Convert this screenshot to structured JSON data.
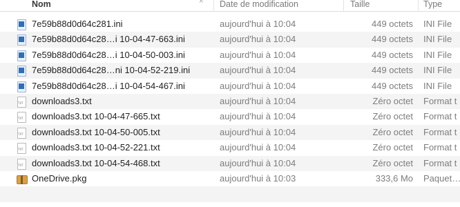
{
  "columns": {
    "name": "Nom",
    "date": "Date de modification",
    "size": "Taille",
    "type": "Type"
  },
  "sort_indicator": "^",
  "files": [
    {
      "name": "7e59b88d0d64c281.ini",
      "date": "aujourd'hui à 10:04",
      "size": "449 octets",
      "type": "INI File",
      "icon": "ini-file-icon"
    },
    {
      "name": "7e59b88d0d64c28…i 10-04-47-663.ini",
      "date": "aujourd'hui à 10:04",
      "size": "449 octets",
      "type": "INI File",
      "icon": "ini-file-icon"
    },
    {
      "name": "7e59b88d0d64c28…i 10-04-50-003.ini",
      "date": "aujourd'hui à 10:04",
      "size": "449 octets",
      "type": "INI File",
      "icon": "ini-file-icon"
    },
    {
      "name": "7e59b88d0d64c28…ni 10-04-52-219.ini",
      "date": "aujourd'hui à 10:04",
      "size": "449 octets",
      "type": "INI File",
      "icon": "ini-file-icon"
    },
    {
      "name": "7e59b88d0d64c28…i 10-04-54-467.ini",
      "date": "aujourd'hui à 10:04",
      "size": "449 octets",
      "type": "INI File",
      "icon": "ini-file-icon"
    },
    {
      "name": "downloads3.txt",
      "date": "aujourd'hui à 10:04",
      "size": "Zéro octet",
      "type": "Format t",
      "icon": "text-file-icon"
    },
    {
      "name": "downloads3.txt 10-04-47-665.txt",
      "date": "aujourd'hui à 10:04",
      "size": "Zéro octet",
      "type": "Format t",
      "icon": "text-file-icon"
    },
    {
      "name": "downloads3.txt 10-04-50-005.txt",
      "date": "aujourd'hui à 10:04",
      "size": "Zéro octet",
      "type": "Format t",
      "icon": "text-file-icon"
    },
    {
      "name": "downloads3.txt 10-04-52-221.txt",
      "date": "aujourd'hui à 10:04",
      "size": "Zéro octet",
      "type": "Format t",
      "icon": "text-file-icon"
    },
    {
      "name": "downloads3.txt 10-04-54-468.txt",
      "date": "aujourd'hui à 10:04",
      "size": "Zéro octet",
      "type": "Format t",
      "icon": "text-file-icon"
    },
    {
      "name": "OneDrive.pkg",
      "date": "aujourd'hui à 10:03",
      "size": "333,6 Mo",
      "type": "Paquet…",
      "icon": "package-icon"
    }
  ],
  "icon_text": {
    "txt": "TXT"
  }
}
